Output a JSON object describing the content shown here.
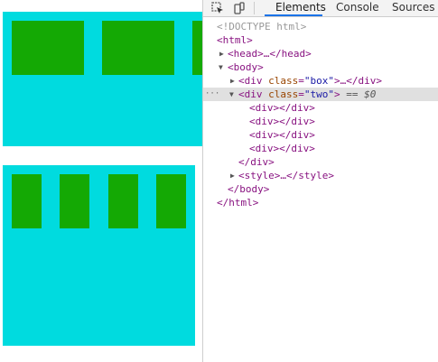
{
  "devtools": {
    "tabs": [
      "Elements",
      "Console",
      "Sources"
    ],
    "active_tab": "Elements",
    "icons": [
      "inspect-element-icon",
      "device-toolbar-icon"
    ],
    "tree": {
      "doctype": "<!DOCTYPE html>",
      "html_open": "<html>",
      "head": "<head>…</head>",
      "body_open": "<body>",
      "div_box": {
        "open": "<div ",
        "attr": "class",
        "eq": "=",
        "val": "\"box\"",
        "rest": ">…</div>"
      },
      "div_two": {
        "open": "<div ",
        "attr": "class",
        "eq": "=",
        "val": "\"two\"",
        "close": ">",
        "marker": "== $0"
      },
      "child_div": "<div></div>",
      "div_close": "</div>",
      "style": "<style>…</style>",
      "body_close": "</body>",
      "html_close": "</html>",
      "gutter": "···"
    }
  },
  "colors": {
    "cyan": "#00DBDF",
    "green": "#14A904",
    "selection": "#e0e0e0",
    "accent": "#1a73e8"
  }
}
